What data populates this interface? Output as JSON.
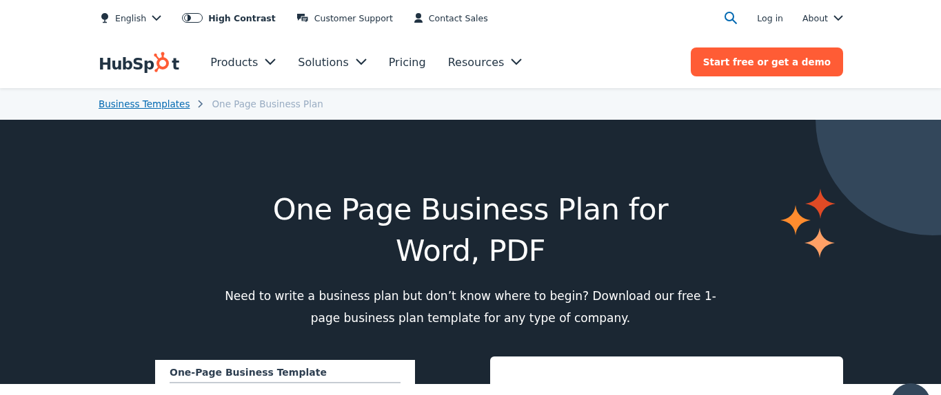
{
  "utility_bar": {
    "language": "English",
    "high_contrast": {
      "label": "High Contrast",
      "on": false
    },
    "links": [
      {
        "kind": "support",
        "label": "Customer Support"
      },
      {
        "kind": "sales",
        "label": "Contact Sales"
      }
    ],
    "login": "Log in",
    "about": "About"
  },
  "nav": {
    "logo": {
      "before": "HubSp",
      "after": "t"
    },
    "items": [
      {
        "label": "Products",
        "dropdown": true
      },
      {
        "label": "Solutions",
        "dropdown": true
      },
      {
        "label": "Pricing",
        "dropdown": false
      },
      {
        "label": "Resources",
        "dropdown": true
      }
    ],
    "cta": "Start free or get a demo"
  },
  "breadcrumb": [
    {
      "label": "Business Templates",
      "current": false
    },
    {
      "label": "One Page Business Plan",
      "current": true
    }
  ],
  "hero": {
    "title_lines": [
      "One Page Business Plan for",
      "Word, PDF"
    ],
    "description": "Need to write a business plan but don’t know where to begin? Download our free 1-page business plan template for any type of company.",
    "preview_title": "One-Page Business Template"
  }
}
